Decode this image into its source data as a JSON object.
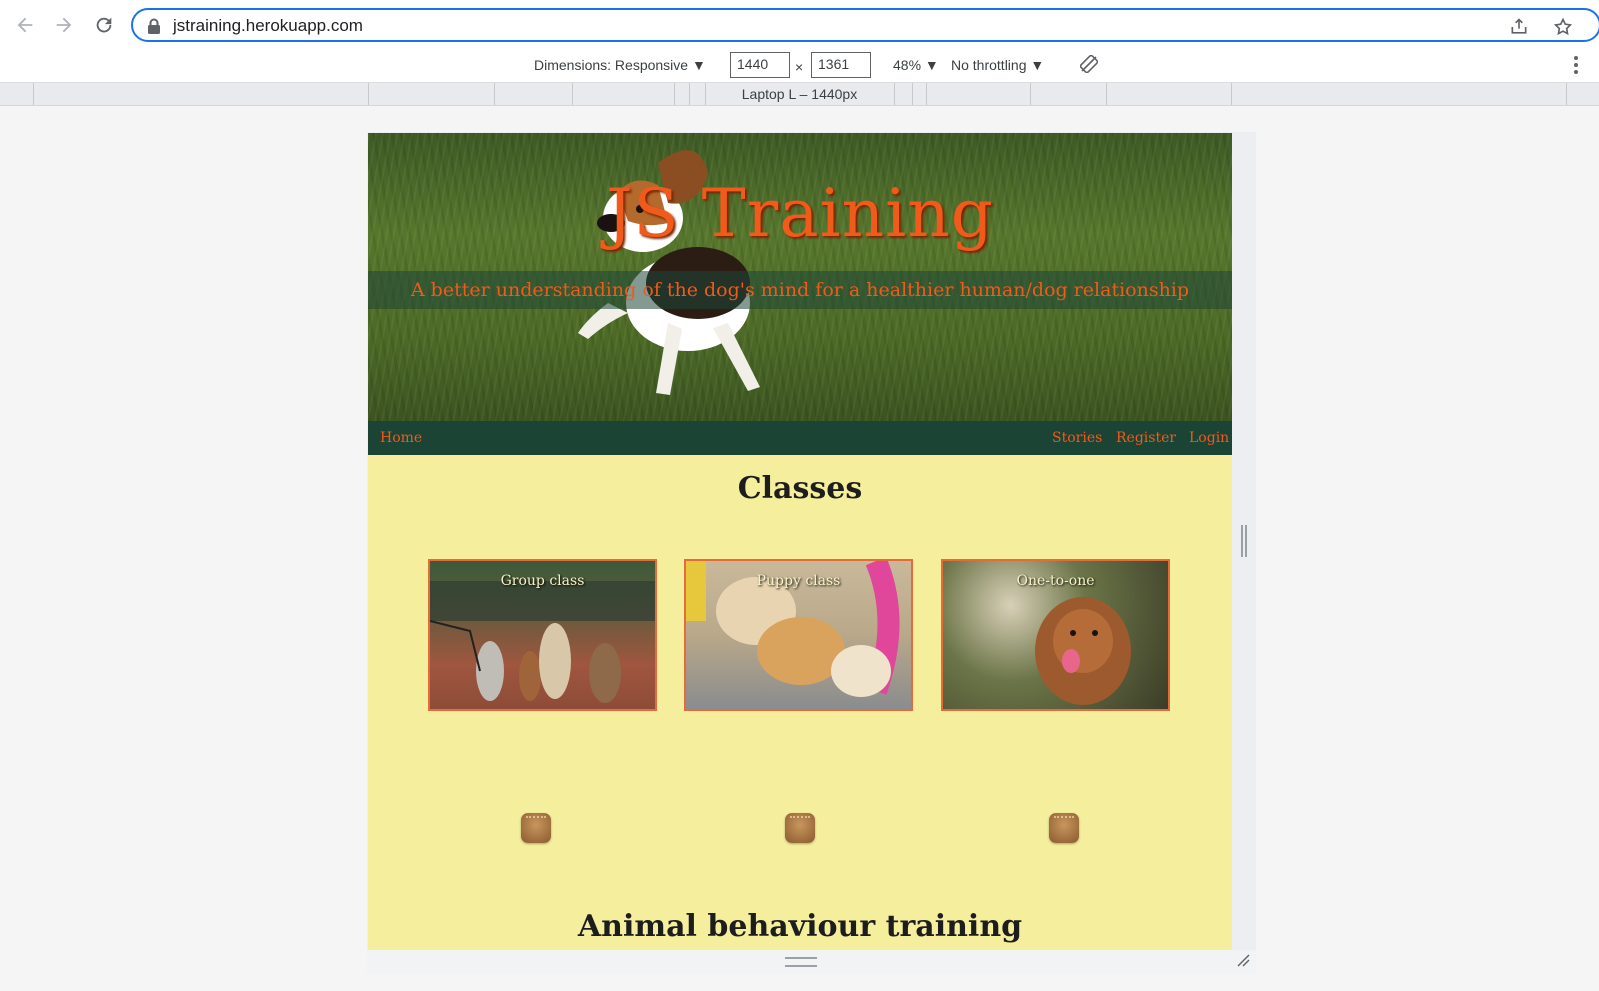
{
  "browser": {
    "url": "jstraining.herokuapp.com"
  },
  "devtools": {
    "dimensions_label": "Dimensions: Responsive ▼",
    "width_value": "1440",
    "times": "×",
    "height_value": "1361",
    "zoom": "48% ▼",
    "throttling": "No throttling ▼",
    "media_label": "Laptop L – 1440px"
  },
  "site": {
    "title": "JS Training",
    "tagline": "A better understanding of the dog's mind for a healthier human/dog relationship",
    "nav": {
      "home": "Home",
      "stories": "Stories",
      "register": "Register",
      "login": "Login"
    },
    "classes_heading": "Classes",
    "cards": [
      {
        "caption": "Group class"
      },
      {
        "caption": "Puppy class"
      },
      {
        "caption": "One-to-one"
      }
    ],
    "behaviour_heading": "Animal behaviour training"
  },
  "colors": {
    "accent": "#f05a1a",
    "nav_bg": "#1c4434",
    "page_bg": "#f5ee9c",
    "focus_ring": "#1a73e8"
  },
  "icons": [
    "back-arrow-icon",
    "forward-arrow-icon",
    "reload-icon",
    "lock-icon",
    "share-icon",
    "star-icon",
    "rotate-icon",
    "kebab-menu-icon",
    "paw-icon"
  ]
}
